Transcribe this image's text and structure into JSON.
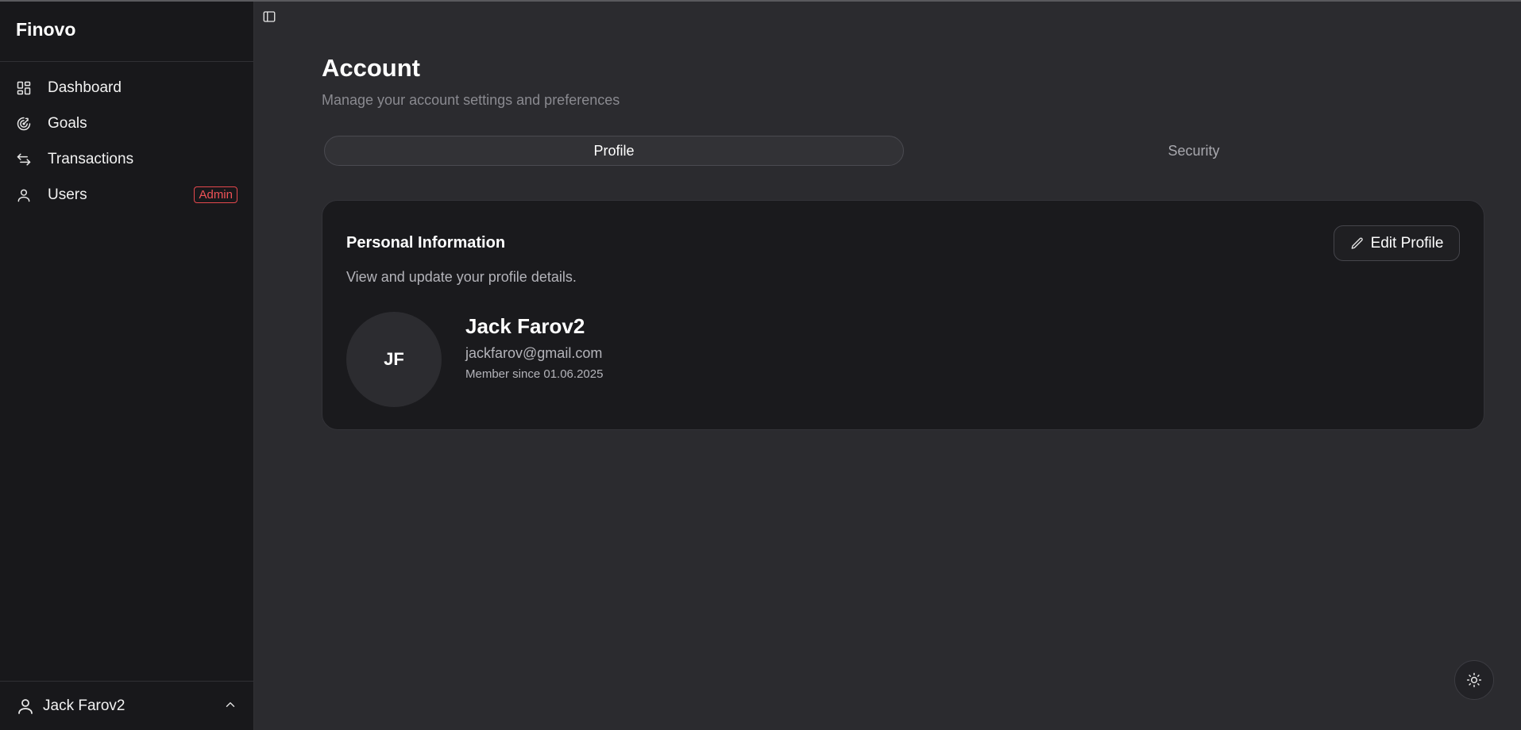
{
  "app": {
    "brand": "Finovo"
  },
  "sidebar": {
    "items": [
      {
        "label": "Dashboard",
        "icon": "dashboard-icon"
      },
      {
        "label": "Goals",
        "icon": "goal-icon"
      },
      {
        "label": "Transactions",
        "icon": "transfer-arrows-icon"
      },
      {
        "label": "Users",
        "icon": "user-icon",
        "badge": "Admin"
      }
    ],
    "footer": {
      "user_name": "Jack Farov2",
      "icon": "user-icon",
      "chevron": "chevron-up-icon"
    }
  },
  "page": {
    "title": "Account",
    "subtitle": "Manage your account settings and preferences"
  },
  "tabs": [
    {
      "label": "Profile",
      "active": true
    },
    {
      "label": "Security",
      "active": false
    }
  ],
  "card": {
    "title": "Personal Information",
    "description": "View and update your profile details.",
    "edit_label": "Edit Profile",
    "edit_icon": "pencil-icon",
    "avatar_initials": "JF",
    "name": "Jack Farov2",
    "email": "jackfarov@gmail.com",
    "member_since": "Member since 01.06.2025"
  },
  "theme_toggle": {
    "icon": "sun-icon"
  },
  "colors": {
    "background": "#2b2b2f",
    "sidebar": "#18181b",
    "card": "#1a1a1d",
    "admin_badge": "#ef5257"
  }
}
